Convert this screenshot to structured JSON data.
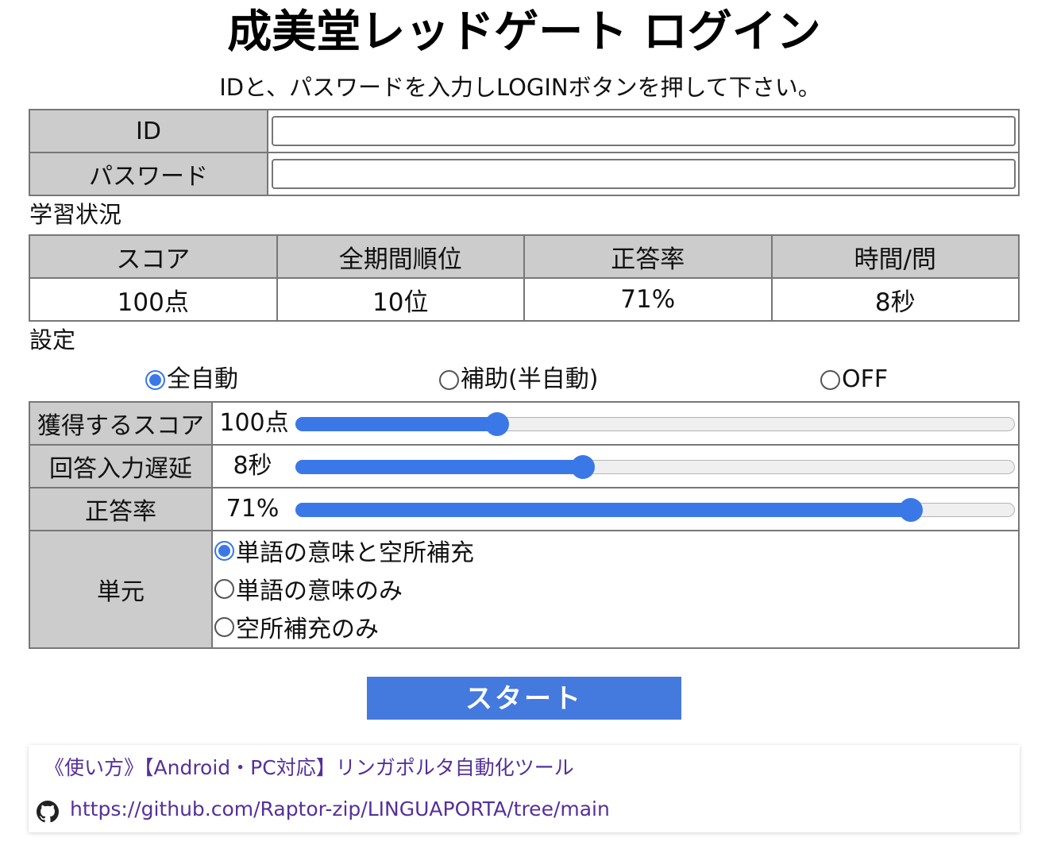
{
  "title": "成美堂レッドゲート ログイン",
  "instruction": "IDと、パスワードを入力しLOGINボタンを押して下さい。",
  "login": {
    "id_label": "ID",
    "id_value": "",
    "password_label": "パスワード",
    "password_value": ""
  },
  "status": {
    "section_label": "学習状況",
    "headers": [
      "スコア",
      "全期間順位",
      "正答率",
      "時間/問"
    ],
    "values": [
      "100点",
      "10位",
      "71%",
      "8秒"
    ]
  },
  "settings": {
    "section_label": "設定",
    "modes": [
      {
        "label": "全自動",
        "checked": true
      },
      {
        "label": "補助(半自動)",
        "checked": false
      },
      {
        "label": "OFF",
        "checked": false
      }
    ],
    "score_label": "獲得するスコア",
    "score_value": "100点",
    "score_fraction": 0.28,
    "delay_label": "回答入力遅延",
    "delay_value": "8秒",
    "delay_fraction": 0.4,
    "accuracy_label": "正答率",
    "accuracy_value": "71%",
    "accuracy_fraction": 0.855,
    "unit_label": "単元",
    "units": [
      {
        "label": "単語の意味と空所補充",
        "checked": true
      },
      {
        "label": "単語の意味のみ",
        "checked": false
      },
      {
        "label": "空所補充のみ",
        "checked": false
      }
    ]
  },
  "start_label": "スタート",
  "footer": {
    "guide_link": "《使い方》【Android・PC対応】リンガポルタ自動化ツール",
    "github_icon": "github-icon",
    "github_link": "https://github.com/Raptor-zip/LINGUAPORTA/tree/main"
  },
  "colors": {
    "accent": "#3b78e7",
    "button": "#4479dd",
    "header_bg": "#cccccc",
    "link": "#55309a"
  }
}
